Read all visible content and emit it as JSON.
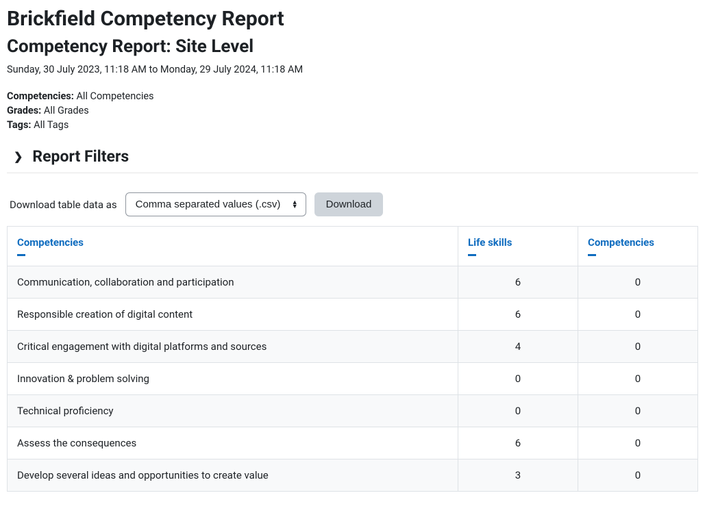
{
  "page_title": "Brickfield Competency Report",
  "subtitle": "Competency Report: Site Level",
  "date_range": "Sunday, 30 July 2023, 11:18 AM to Monday, 29 July 2024, 11:18 AM",
  "meta": {
    "competencies_label": "Competencies:",
    "competencies_value": "All Competencies",
    "grades_label": "Grades:",
    "grades_value": "All Grades",
    "tags_label": "Tags:",
    "tags_value": "All Tags"
  },
  "filters_heading": "Report Filters",
  "download": {
    "label": "Download table data as",
    "selected": "Comma separated values (.csv)",
    "button": "Download"
  },
  "table": {
    "headers": [
      "Competencies",
      "Life skills",
      "Competencies"
    ],
    "rows": [
      {
        "name": "Communication, collaboration and participation",
        "life_skills": "6",
        "competencies": "0"
      },
      {
        "name": "Responsible creation of digital content",
        "life_skills": "6",
        "competencies": "0"
      },
      {
        "name": "Critical engagement with digital platforms and sources",
        "life_skills": "4",
        "competencies": "0"
      },
      {
        "name": "Innovation & problem solving",
        "life_skills": "0",
        "competencies": "0"
      },
      {
        "name": "Technical proficiency",
        "life_skills": "0",
        "competencies": "0"
      },
      {
        "name": "Assess the consequences",
        "life_skills": "6",
        "competencies": "0"
      },
      {
        "name": "Develop several ideas and opportunities to create value",
        "life_skills": "3",
        "competencies": "0"
      }
    ]
  }
}
